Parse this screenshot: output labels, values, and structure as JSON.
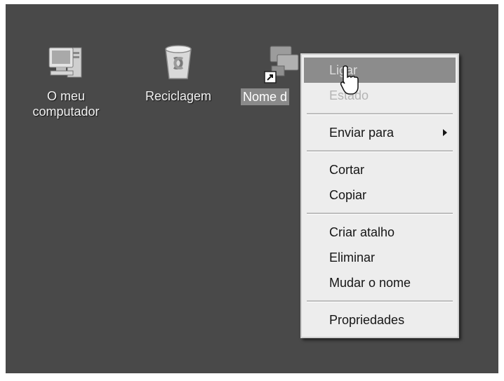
{
  "desktop": {
    "background": "#494949",
    "icons": [
      {
        "label_line1": "O meu",
        "label_line2": "computador",
        "icon": "my-computer-icon"
      },
      {
        "label": "Reciclagem",
        "icon": "recycle-bin-icon"
      },
      {
        "label": "Nome d",
        "icon": "network-shortcut-icon"
      }
    ]
  },
  "context_menu": {
    "items": [
      {
        "label": "Ligar",
        "state": "highlighted"
      },
      {
        "label": "Estado",
        "state": "disabled"
      },
      {
        "label": "Enviar para",
        "submenu": true
      },
      {
        "label": "Cortar"
      },
      {
        "label": "Copiar"
      },
      {
        "label": "Criar atalho"
      },
      {
        "label": "Eliminar"
      },
      {
        "label": "Mudar o nome"
      },
      {
        "label": "Propriedades"
      }
    ],
    "highlight_color": "#8c8c8c"
  }
}
